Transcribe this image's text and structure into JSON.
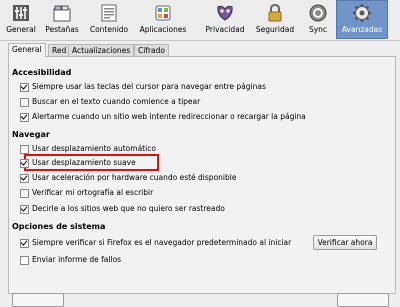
{
  "toolbar": {
    "items": [
      {
        "label": "General",
        "icon": "general-icon"
      },
      {
        "label": "Pestañas",
        "icon": "tabs-icon"
      },
      {
        "label": "Contenido",
        "icon": "content-icon"
      },
      {
        "label": "Aplicaciones",
        "icon": "applications-icon"
      },
      {
        "label": "Privacidad",
        "icon": "privacy-mask-icon"
      },
      {
        "label": "Seguridad",
        "icon": "lock-icon"
      },
      {
        "label": "Sync",
        "icon": "sync-icon"
      },
      {
        "label": "Avanzadas",
        "icon": "gear-icon"
      }
    ],
    "active_index": 7
  },
  "tabs": [
    {
      "label": "General"
    },
    {
      "label": "Red"
    },
    {
      "label": "Actualizaciones"
    },
    {
      "label": "Cifrado"
    }
  ],
  "accessibility": {
    "heading": "Accesibilidad",
    "options": [
      {
        "label": "Siempre usar las teclas del cursor para navegar entre páginas",
        "checked": true
      },
      {
        "label": "Buscar en el texto cuando comience a tipear",
        "checked": false
      },
      {
        "label": "Alertarme cuando un sitio web intente redireccionar o recargar la página",
        "checked": true
      }
    ]
  },
  "browsing": {
    "heading": "Navegar",
    "options": [
      {
        "label": "Usar desplazamiento automático",
        "checked": false
      },
      {
        "label": "Usar desplazamiento suave",
        "checked": true
      },
      {
        "label": "Usar aceleración por hardware cuando esté disponible",
        "checked": true
      },
      {
        "label": "Verificar mi ortografía al escribir",
        "checked": false
      },
      {
        "label": "Decirle a los sitios web que no quiero ser rastreado",
        "checked": true
      }
    ]
  },
  "system": {
    "heading": "Opciones de sistema",
    "default_check": {
      "label": "Siempre verificar si Firefox es el navegador predeterminado al iniciar",
      "checked": true
    },
    "check_now_label": "Verificar ahora",
    "crash_report": {
      "label": "Enviar informe de fallos",
      "checked": false
    }
  },
  "colors": {
    "active_tab": "#6f94c8",
    "highlight": "#e01010"
  }
}
